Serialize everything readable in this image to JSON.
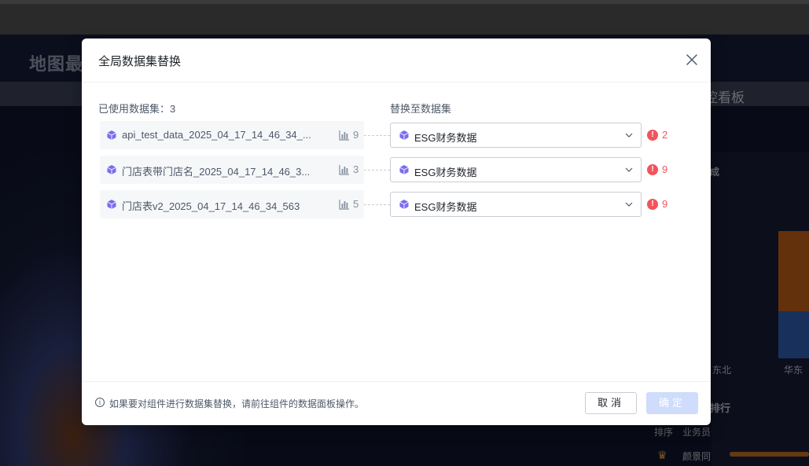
{
  "background": {
    "dashboard_title": "地图最",
    "band_label": "控看板",
    "city_label": "成",
    "region_labels": [
      "东北",
      "华东"
    ],
    "ranking_label": "排行",
    "table_headers": [
      "排序",
      "业务员"
    ],
    "top_name": "颜景同"
  },
  "dialog": {
    "title": "全局数据集替换",
    "used_label": "已使用数据集：3",
    "replace_label": "替换至数据集",
    "rows": [
      {
        "source_name": "api_test_data_2025_04_17_14_46_34_...",
        "source_count": "9",
        "target_value": "ESG财务数据",
        "warning_count": "2"
      },
      {
        "source_name": "门店表带门店名_2025_04_17_14_46_3...",
        "source_count": "3",
        "target_value": "ESG财务数据",
        "warning_count": "9"
      },
      {
        "source_name": "门店表v2_2025_04_17_14_46_34_563",
        "source_count": "5",
        "target_value": "ESG财务数据",
        "warning_count": "9"
      }
    ],
    "footer_tip": "如果要对组件进行数据集替换，请前往组件的数据面板操作。",
    "cancel_label": "取消",
    "ok_label": "确定"
  },
  "colors": {
    "accent": "#2b6cf6",
    "dataset_icon": "#7b6cf0",
    "warning": "#f2545b"
  },
  "icons": {
    "close": "close-icon",
    "dataset": "cube-icon",
    "chart": "bar-chart-icon",
    "dropdown": "chevron-down-icon",
    "warning": "exclamation-circle-icon",
    "info": "info-circle-icon"
  }
}
